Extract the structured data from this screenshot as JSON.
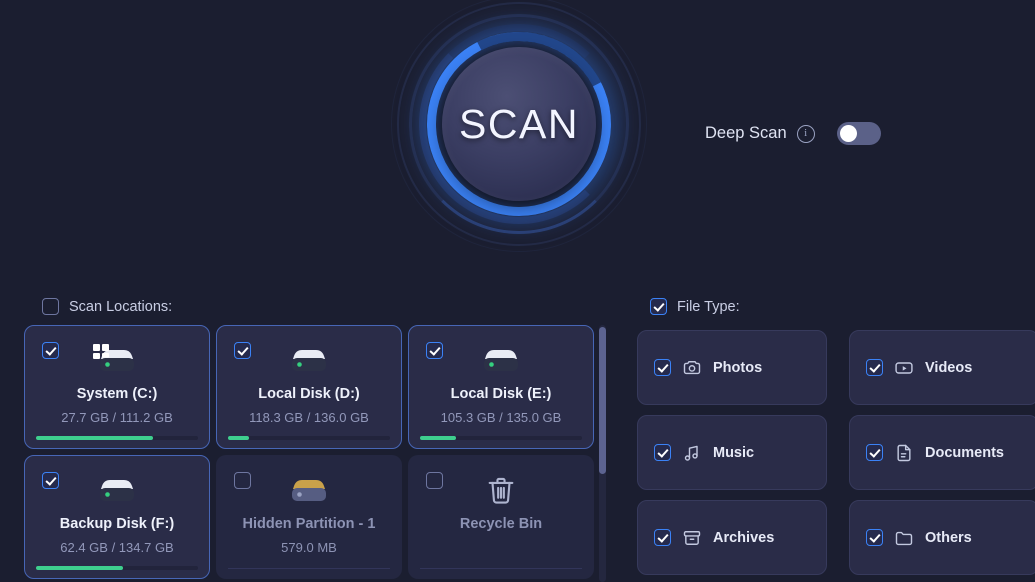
{
  "scan": {
    "button_label": "SCAN",
    "deep_scan_label": "Deep Scan",
    "deep_scan_enabled": false,
    "info_glyph": "i"
  },
  "locations": {
    "title": "Scan Locations:",
    "all_checked": false,
    "items": [
      {
        "name": "System (C:)",
        "size": "27.7 GB / 111.2 GB",
        "checked": true,
        "icon": "windows-drive-icon",
        "used_percent": 72,
        "dim": false
      },
      {
        "name": "Local Disk (D:)",
        "size": "118.3 GB / 136.0 GB",
        "checked": true,
        "icon": "drive-icon",
        "used_percent": 13,
        "dim": false
      },
      {
        "name": "Local Disk (E:)",
        "size": "105.3 GB / 135.0 GB",
        "checked": true,
        "icon": "drive-icon",
        "used_percent": 22,
        "dim": false
      },
      {
        "name": "Backup Disk (F:)",
        "size": "62.4 GB / 134.7 GB",
        "checked": true,
        "icon": "drive-icon",
        "used_percent": 54,
        "dim": false
      },
      {
        "name": "Hidden Partition - 1",
        "size": "579.0 MB",
        "checked": false,
        "icon": "hidden-partition-icon",
        "used_percent": null,
        "dim": true
      },
      {
        "name": "Recycle Bin",
        "size": "",
        "checked": false,
        "icon": "recycle-bin-icon",
        "used_percent": null,
        "dim": true
      }
    ]
  },
  "file_types": {
    "title": "File Type:",
    "all_checked": true,
    "items": [
      {
        "label": "Photos",
        "icon": "camera-icon",
        "checked": true
      },
      {
        "label": "Videos",
        "icon": "video-icon",
        "checked": true
      },
      {
        "label": "Music",
        "icon": "music-note-icon",
        "checked": true
      },
      {
        "label": "Documents",
        "icon": "document-icon",
        "checked": true
      },
      {
        "label": "Archives",
        "icon": "archive-box-icon",
        "checked": true
      },
      {
        "label": "Others",
        "icon": "folder-icon",
        "checked": true
      }
    ]
  },
  "colors": {
    "background": "#1b1e30",
    "accent": "#3b82f6",
    "card": "#2a2c48",
    "progress": "#3ecf8e"
  }
}
